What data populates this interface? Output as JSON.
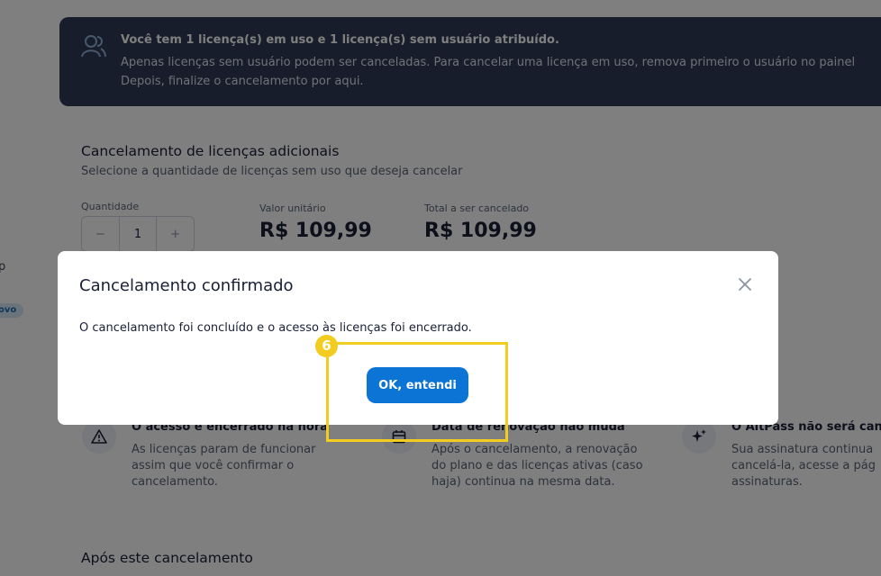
{
  "sidebar": {
    "item_fragment": "p",
    "badge": "ovo"
  },
  "banner": {
    "title": "Você tem 1 licença(s) em uso e 1 licença(s) sem usuário atribuído.",
    "line1": "Apenas licenças sem usuário podem ser canceladas. Para cancelar uma licença em uso, remova primeiro o usuário no painel",
    "line2": "Depois, finalize o cancelamento por aqui.",
    "icon": "users-icon"
  },
  "cancel_section": {
    "title": "Cancelamento de licenças adicionais",
    "subtitle": "Selecione a quantidade de licenças sem uso que deseja cancelar",
    "quantity_label": "Quantidade",
    "stepper": {
      "minus": "−",
      "value": "1",
      "plus": "+"
    },
    "unit_price_label": "Valor unitário",
    "unit_price": "R$ 109,99",
    "total_label": "Total a ser cancelado",
    "total": "R$ 109,99"
  },
  "info_items": [
    {
      "icon": "warning-icon",
      "title": "O acesso é encerrado na hora",
      "lines": [
        "As licenças param de funcionar",
        "assim que você confirmar o",
        "cancelamento."
      ]
    },
    {
      "icon": "calendar-icon",
      "title": "Data de renovação não muda",
      "lines": [
        "Após o cancelamento, a renovação",
        "do plano e das licenças ativas (caso",
        "haja) continua na mesma data."
      ]
    },
    {
      "icon": "sparkles-icon",
      "title": "O AltPass não será cance",
      "lines": [
        "Sua assinatura continua",
        "cancelá-la, acesse a pág",
        "assinaturas."
      ]
    }
  ],
  "after_title": "Após este cancelamento",
  "modal": {
    "title": "Cancelamento confirmado",
    "message": "O cancelamento foi concluído e o acesso às licenças foi encerrado.",
    "ok_label": "OK, entendi",
    "close_icon": "close-icon"
  },
  "annotation": {
    "step_number": "6",
    "color": "#f2cc1f"
  },
  "colors": {
    "primary_button": "#0b74d4",
    "banner_bg": "#2f3a54",
    "overlay": "rgba(0,0,0,0.5)"
  }
}
